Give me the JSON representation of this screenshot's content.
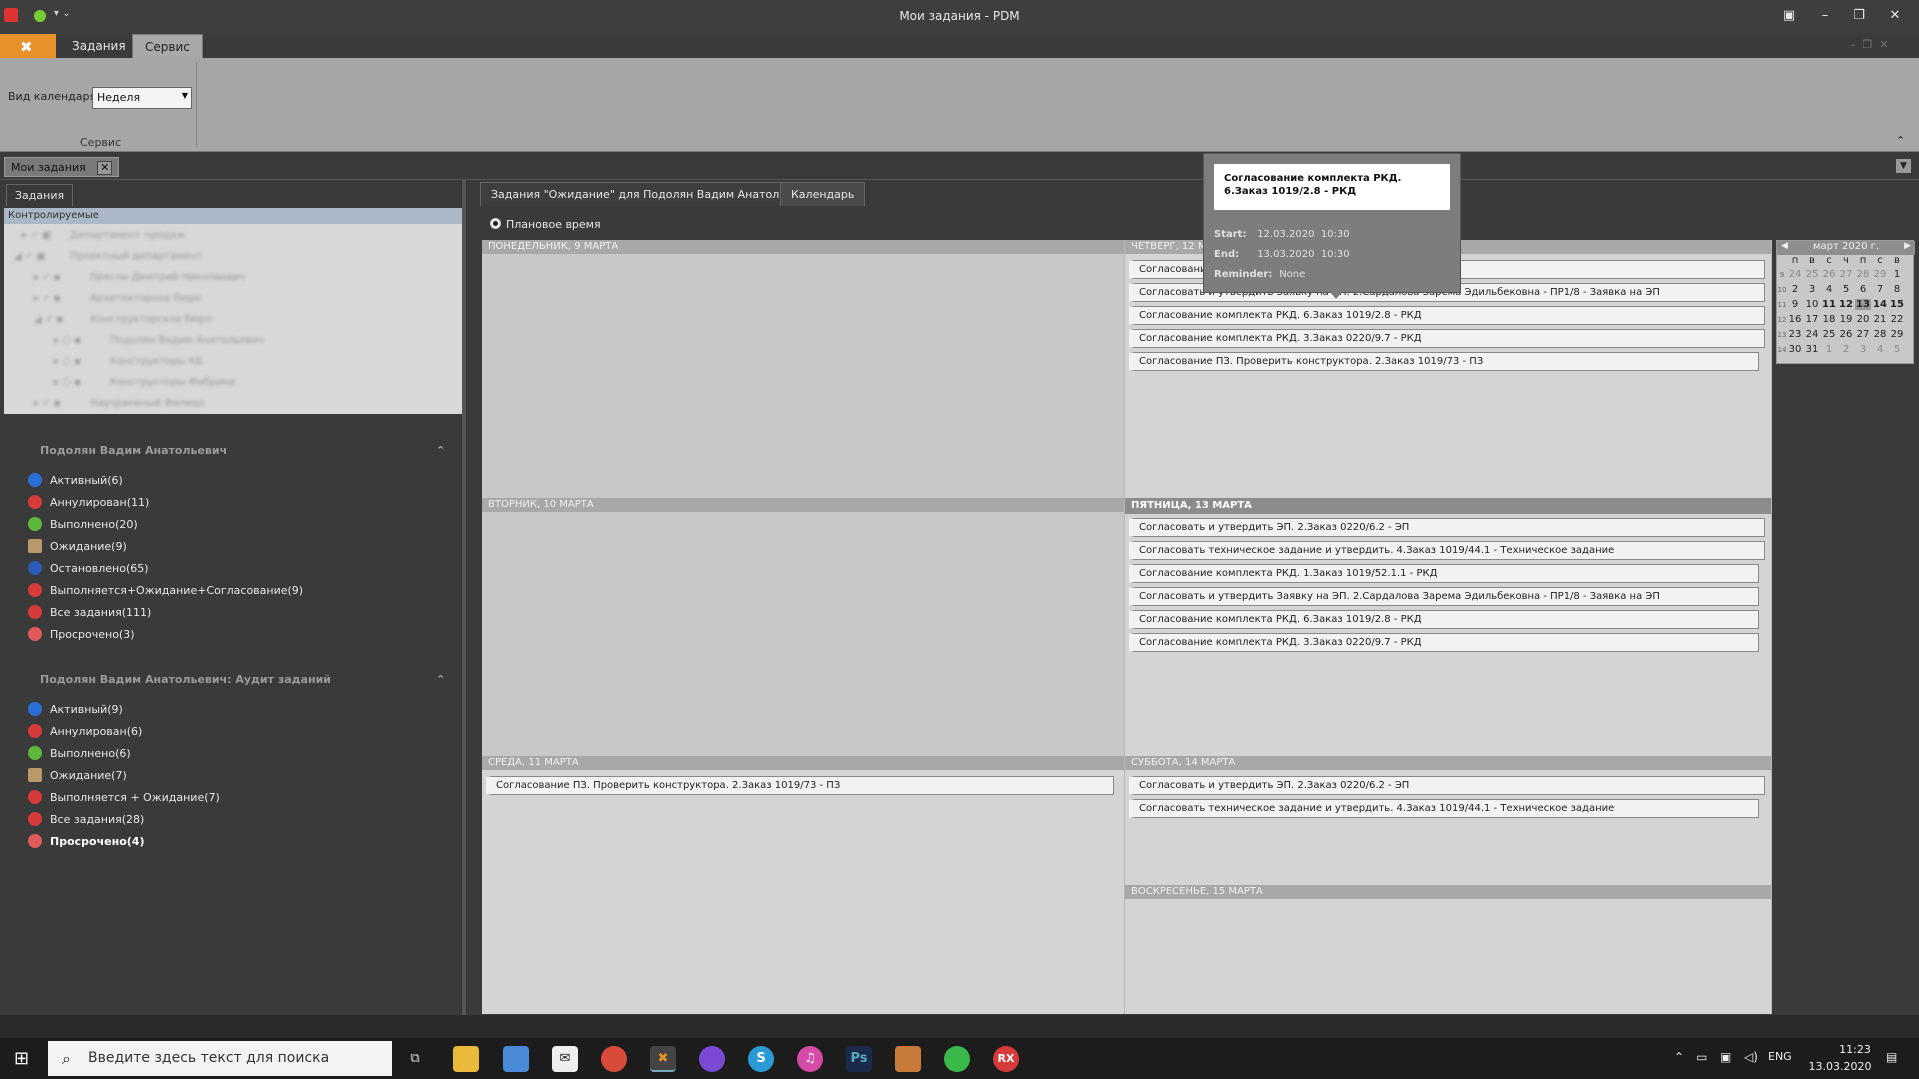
{
  "window": {
    "title": "Мои задания - PDM"
  },
  "ribbon": {
    "tabs": [
      "Задания",
      "Сервис"
    ],
    "active_tab": "Сервис",
    "calendar_view_label": "Вид календаря",
    "calendar_view_value": "Неделя",
    "group_label": "Сервис"
  },
  "doc_tab": {
    "label": "Мои задания",
    "close": "✕"
  },
  "left": {
    "tab": "Задания",
    "tree_header": "Контролируемые",
    "tree_rows": [
      "Департамент продаж",
      "Проектный департамент",
      "Пресли Дмитрий Николаевич",
      "Архитекторное бюро",
      "Конструкторское бюро",
      "Подолян Вадим Анатольевич",
      "Конструкторы КБ",
      "Конструкторы Фабрики",
      "Научраевный Филиал"
    ],
    "group1": {
      "title": "Подолян Вадим Анатольевич",
      "items": [
        "Активный(6)",
        "Аннулирован(11)",
        "Выполнено(20)",
        "Ожидание(9)",
        "Остановлено(65)",
        "Выполняется+Ожидание+Согласование(9)",
        "Все задания(111)",
        "Просрочено(3)"
      ]
    },
    "group2": {
      "title": "Подолян Вадим Анатольевич: Аудит заданий",
      "items": [
        "Активный(9)",
        "Аннулирован(6)",
        "Выполнено(6)",
        "Ожидание(7)",
        "Выполняется + Ожидание(7)",
        "Все задания(28)",
        "Просрочено(4)"
      ]
    }
  },
  "main": {
    "tabs": [
      "Задания \"Ожидание\" для Подолян Вадим Анатольевич",
      "Календарь"
    ],
    "radio_label": "Плановое время",
    "days": {
      "mon": {
        "title": "ПОНЕДЕЛЬНИК, 9 МАРТА",
        "items": []
      },
      "tue": {
        "title": "ВТОРНИК, 10 МАРТА",
        "items": []
      },
      "wed": {
        "title": "СРЕДА, 11 МАРТА",
        "items": [
          "Согласование ПЗ. Проверить конструктора. 2.Заказ 1019/73 - ПЗ"
        ]
      },
      "thu": {
        "title": "ЧЕТВЕРГ, 12 МАРТА",
        "items": [
          "Согласование и утвердить ЭП. 2.Заказ 0220/6.2 - ЭП",
          "Согласовать и утвердить Заявку на ЭП. 2.Сардалова Зарема Эдильбековна - ПР1/8 - Заявка на ЭП",
          "Согласование комплекта РКД. 6.Заказ 1019/2.8 - РКД",
          "Согласование комплекта РКД. 3.Заказ 0220/9.7 - РКД",
          "Согласование ПЗ. Проверить конструктора. 2.Заказ 1019/73 - ПЗ"
        ]
      },
      "fri": {
        "title": "ПЯТНИЦА, 13 МАРТА",
        "items": [
          "Согласовать и утвердить ЭП. 2.Заказ 0220/6.2 - ЭП",
          "Согласовать техническое задание и утвердить. 4.Заказ 1019/44.1 - Техническое задание",
          "Согласование комплекта РКД. 1.Заказ 1019/52.1.1 - РКД",
          "Согласовать и утвердить Заявку на ЭП. 2.Сардалова Зарема Эдильбековна - ПР1/8 - Заявка на ЭП",
          "Согласование комплекта РКД. 6.Заказ 1019/2.8 - РКД",
          "Согласование комплекта РКД. 3.Заказ 0220/9.7 - РКД"
        ]
      },
      "sat": {
        "title": "СУББОТА, 14 МАРТА",
        "items": [
          "Согласовать и утвердить ЭП. 2.Заказ 0220/6.2 - ЭП",
          "Согласовать техническое задание и утвердить. 4.Заказ 1019/44.1 - Техническое задание"
        ]
      },
      "sun": {
        "title": "ВОСКРЕСЕНЬЕ, 15 МАРТА",
        "items": []
      }
    }
  },
  "tooltip": {
    "title": "Согласование комплекта РКД. 6.Заказ 1019/2.8 - РКД",
    "start_label": "Start:",
    "start_date": "12.03.2020",
    "start_time": "10:30",
    "end_label": "End:",
    "end_date": "13.03.2020",
    "end_time": "10:30",
    "reminder_label": "Reminder:",
    "reminder_value": "None"
  },
  "minical": {
    "title": "март 2020 г.",
    "weekdays": [
      "п",
      "в",
      "с",
      "ч",
      "п",
      "с",
      "в"
    ],
    "weeks": [
      {
        "wk": "9",
        "days": [
          "24",
          "25",
          "26",
          "27",
          "28",
          "29",
          "1"
        ]
      },
      {
        "wk": "10",
        "days": [
          "2",
          "3",
          "4",
          "5",
          "6",
          "7",
          "8"
        ]
      },
      {
        "wk": "11",
        "days": [
          "9",
          "10",
          "11",
          "12",
          "13",
          "14",
          "15"
        ]
      },
      {
        "wk": "12",
        "days": [
          "16",
          "17",
          "18",
          "19",
          "20",
          "21",
          "22"
        ]
      },
      {
        "wk": "13",
        "days": [
          "23",
          "24",
          "25",
          "26",
          "27",
          "28",
          "29"
        ]
      },
      {
        "wk": "14",
        "days": [
          "30",
          "31",
          "1",
          "2",
          "3",
          "4",
          "5"
        ]
      }
    ]
  },
  "taskbar": {
    "search_placeholder": "Введите здесь текст для поиска",
    "lang": "ENG",
    "time": "11:23",
    "date": "13.03.2020"
  },
  "colors": {
    "accent": "#e8902a",
    "calendar_bg": "#d4d4d4",
    "panel_bg": "#3a3a3a"
  }
}
